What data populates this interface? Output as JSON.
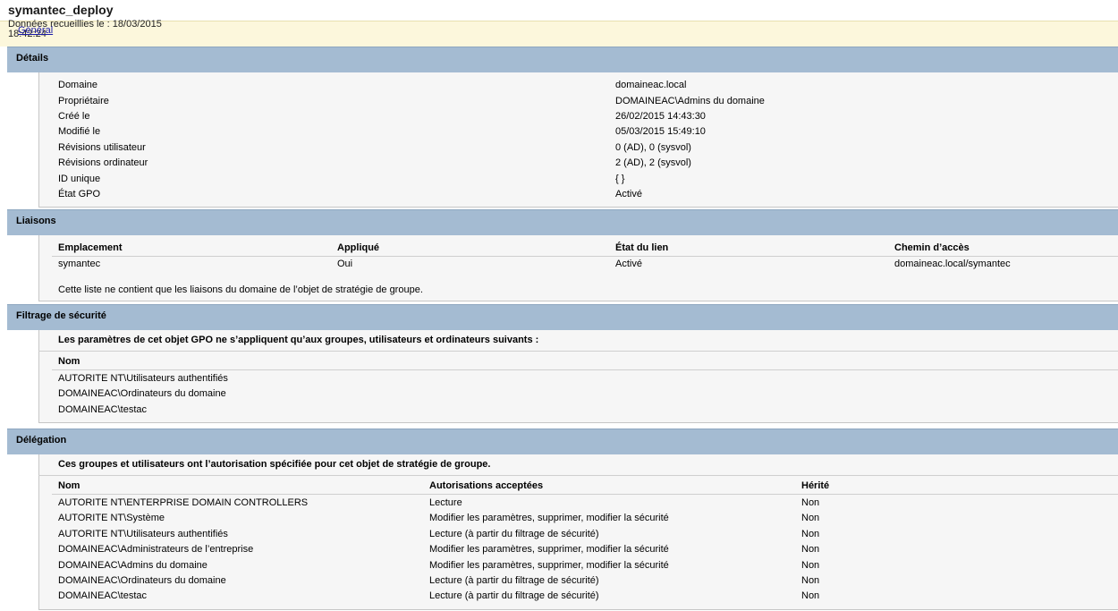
{
  "title": "symantec_deploy",
  "info": {
    "collected": "Données recueillies le : 18/03/2015",
    "time": "18:42:24",
    "general_link": "Général"
  },
  "details": {
    "title": "Détails",
    "rows": [
      {
        "label": "Domaine",
        "value": "domaineac.local"
      },
      {
        "label": "Propriétaire",
        "value": "DOMAINEAC\\Admins du domaine"
      },
      {
        "label": "Créé le",
        "value": "26/02/2015 14:43:30"
      },
      {
        "label": "Modifié le",
        "value": "05/03/2015 15:49:10"
      },
      {
        "label": "Révisions utilisateur",
        "value": "0 (AD), 0 (sysvol)"
      },
      {
        "label": "Révisions ordinateur",
        "value": "2 (AD), 2 (sysvol)"
      },
      {
        "label": "ID unique",
        "value": "{                                                     }"
      },
      {
        "label": "État GPO",
        "value": "Activé"
      }
    ]
  },
  "links": {
    "title": "Liaisons",
    "headers": [
      "Emplacement",
      "Appliqué",
      "État du lien",
      "Chemin d’accès"
    ],
    "rows": [
      [
        "symantec",
        "Oui",
        "Activé",
        "domaineac.local/symantec"
      ]
    ],
    "note": "Cette liste ne contient que les liaisons du domaine de l’objet de stratégie de groupe."
  },
  "security": {
    "title": "Filtrage de sécurité",
    "description": "Les paramètres de cet objet GPO ne s’appliquent qu’aux groupes, utilisateurs et ordinateurs suivants :",
    "header": "Nom",
    "rows": [
      "AUTORITE NT\\Utilisateurs authentifiés",
      "DOMAINEAC\\Ordinateurs du domaine",
      "DOMAINEAC\\testac"
    ]
  },
  "delegation": {
    "title": "Délégation",
    "description": "Ces groupes et utilisateurs ont l’autorisation spécifiée pour cet objet de stratégie de groupe.",
    "headers": [
      "Nom",
      "Autorisations acceptées",
      "Hérité"
    ],
    "rows": [
      [
        "AUTORITE NT\\ENTERPRISE DOMAIN CONTROLLERS",
        "Lecture",
        "Non"
      ],
      [
        "AUTORITE NT\\Système",
        "Modifier les paramètres, supprimer, modifier la sécurité",
        "Non"
      ],
      [
        "AUTORITE NT\\Utilisateurs authentifiés",
        "Lecture (à partir du filtrage de sécurité)",
        "Non"
      ],
      [
        "DOMAINEAC\\Administrateurs de l’entreprise",
        "Modifier les paramètres, supprimer, modifier la sécurité",
        "Non"
      ],
      [
        "DOMAINEAC\\Admins du domaine",
        "Modifier les paramètres, supprimer, modifier la sécurité",
        "Non"
      ],
      [
        "DOMAINEAC\\Ordinateurs du domaine",
        "Lecture (à partir du filtrage de sécurité)",
        "Non"
      ],
      [
        "DOMAINEAC\\testac",
        "Lecture (à partir du filtrage de sécurité)",
        "Non"
      ]
    ]
  }
}
